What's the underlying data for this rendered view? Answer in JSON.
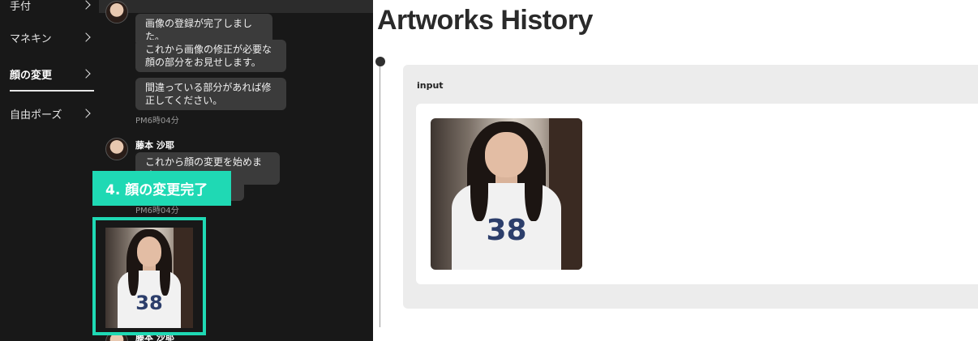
{
  "sidebar": {
    "items": [
      {
        "label": "手付"
      },
      {
        "label": "マネキン"
      },
      {
        "label": "顔の変更",
        "active": true
      },
      {
        "label": "自由ポーズ"
      }
    ]
  },
  "chat": {
    "messages_1": [
      "画像の登録が完了しました。",
      "これから画像の修正が必要な顔の部分をお見せします。",
      "間違っている部分があれば修正してください。"
    ],
    "time_1": "PM6時04分",
    "sender_2": "藤本 沙耶",
    "message_2a": "これから顔の変更を始めます。",
    "time_2": "PM6時04分",
    "sender_3": "藤本 沙耶",
    "jersey_number": "38"
  },
  "overlay": {
    "step_label": "4. 顔の変更完了"
  },
  "history": {
    "title": "Artworks History",
    "card_label": "input",
    "jersey_number": "38"
  },
  "colors": {
    "accent": "#1fd9b4",
    "dark_bg": "#181818",
    "bubble": "#3b3b3b",
    "card_bg": "#ececec"
  }
}
